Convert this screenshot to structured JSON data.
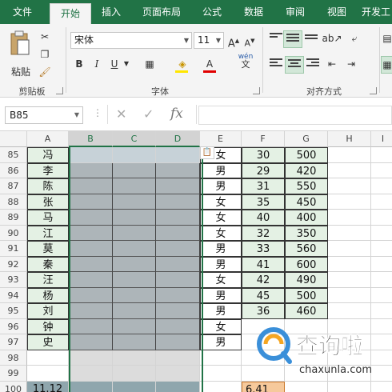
{
  "ribbon_tabs": [
    "文件",
    "开始",
    "插入",
    "页面布局",
    "公式",
    "数据",
    "审阅",
    "视图",
    "开发工"
  ],
  "active_tab": "开始",
  "clipboard": {
    "paste_label": "粘贴",
    "group_label": "剪贴板"
  },
  "font": {
    "name": "宋体",
    "size": "11",
    "group_label": "字体",
    "bold": "B",
    "italic": "I",
    "underline": "U",
    "grow": "A",
    "shrink": "A",
    "font_color": "A",
    "phonetic": "wén"
  },
  "alignment": {
    "group_label": "对齐方式"
  },
  "formula_bar": {
    "name_box": "B85",
    "cancel": "✕",
    "enter": "✓",
    "fx": "fx",
    "content": ""
  },
  "columns": [
    "A",
    "B",
    "C",
    "D",
    "E",
    "F",
    "G",
    "H",
    "I"
  ],
  "rows": [
    {
      "num": "85",
      "a": "冯",
      "e": "女",
      "f": "30",
      "g": "500"
    },
    {
      "num": "86",
      "a": "李",
      "e": "男",
      "f": "29",
      "g": "420"
    },
    {
      "num": "87",
      "a": "陈",
      "e": "男",
      "f": "31",
      "g": "550"
    },
    {
      "num": "88",
      "a": "张",
      "e": "女",
      "f": "35",
      "g": "450"
    },
    {
      "num": "89",
      "a": "马",
      "e": "女",
      "f": "40",
      "g": "400"
    },
    {
      "num": "90",
      "a": "江",
      "e": "女",
      "f": "32",
      "g": "350"
    },
    {
      "num": "91",
      "a": "莫",
      "e": "男",
      "f": "33",
      "g": "560"
    },
    {
      "num": "92",
      "a": "秦",
      "e": "男",
      "f": "41",
      "g": "600"
    },
    {
      "num": "93",
      "a": "汪",
      "e": "女",
      "f": "42",
      "g": "490"
    },
    {
      "num": "94",
      "a": "杨",
      "e": "男",
      "f": "45",
      "g": "500"
    },
    {
      "num": "95",
      "a": "刘",
      "e": "男",
      "f": "36",
      "g": "460"
    },
    {
      "num": "96",
      "a": "钟",
      "e": "女",
      "f": "",
      "g": ""
    },
    {
      "num": "97",
      "a": "史",
      "e": "男",
      "f": "",
      "g": ""
    },
    {
      "num": "98",
      "a": "",
      "e": "",
      "f": "",
      "g": ""
    },
    {
      "num": "99",
      "a": "",
      "e": "",
      "f": "",
      "g": ""
    },
    {
      "num": "100",
      "a": "11.12",
      "e": "",
      "f": "6.41",
      "g": ""
    }
  ],
  "watermark": {
    "brand": "查询啦",
    "url": "chaxunla.com"
  },
  "colors": {
    "excel_green": "#217346",
    "selected_fill": "#adb5b9",
    "cell_green": "#e4f1e4",
    "orange": "#f6c99b"
  }
}
